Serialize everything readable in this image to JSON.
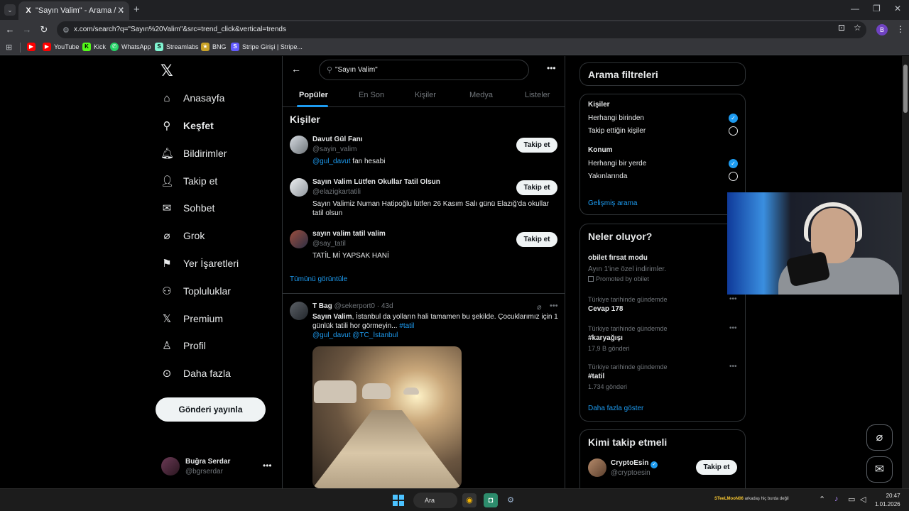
{
  "browser": {
    "tab_title": "\"Sayın Valim\" - Arama / X",
    "tab_favicon": "X",
    "url": "x.com/search?q=\"Sayın%20Valim\"&src=trend_click&vertical=trends",
    "profile_initial": "B",
    "bookmarks": [
      "YouTube",
      "Kick",
      "WhatsApp",
      "Streamlabs",
      "BNG",
      "Stripe Girişi | Stripe..."
    ]
  },
  "sidebar": {
    "items": [
      {
        "label": "Anasayfa",
        "icon": "home-icon"
      },
      {
        "label": "Keşfet",
        "icon": "search-icon"
      },
      {
        "label": "Bildirimler",
        "icon": "bell-icon"
      },
      {
        "label": "Takip et",
        "icon": "add-user-icon"
      },
      {
        "label": "Sohbet",
        "icon": "mail-icon"
      },
      {
        "label": "Grok",
        "icon": "grok-icon"
      },
      {
        "label": "Yer İşaretleri",
        "icon": "bookmark-icon"
      },
      {
        "label": "Topluluklar",
        "icon": "communities-icon"
      },
      {
        "label": "Premium",
        "icon": "x-icon"
      },
      {
        "label": "Profil",
        "icon": "person-icon"
      },
      {
        "label": "Daha fazla",
        "icon": "more-circle-icon"
      }
    ],
    "post_button": "Gönderi yayınla",
    "account": {
      "name": "Buğra Serdar",
      "handle": "@bgrserdar"
    }
  },
  "search": {
    "query": "\"Sayın Valim\"",
    "tabs": [
      "Popüler",
      "En Son",
      "Kişiler",
      "Medya",
      "Listeler"
    ],
    "active_tab": "Popüler"
  },
  "people": {
    "heading": "Kişiler",
    "follow_label": "Takip et",
    "users": [
      {
        "name": "Davut Gül Fanı",
        "handle": "@sayin_valim",
        "bio_mention": "@gul_davut",
        "bio": " fan hesabi"
      },
      {
        "name": "Sayın Valim Lütfen Okullar Tatil Olsun",
        "handle": "@elazigkartatili",
        "bio_mention": "",
        "bio": "Sayın Valimiz Numan Hatipoğlu lütfen 26 Kasım Salı günü Elazığ'da okullar tatil olsun"
      },
      {
        "name": "sayın valim tatil valim",
        "handle": "@say_tatil",
        "bio_mention": "",
        "bio": "TATİL Mİ YAPSAK HANİ"
      }
    ],
    "show_all": "Tümünü görüntüle"
  },
  "tweet": {
    "author": "T Bag",
    "handle": "@sekerport0",
    "time": "· 43d",
    "bold_lead": "Sayın Valim",
    "text": ", İstanbul da yolların hali tamamen bu şekilde. Çocuklarımız için 1 günlük tatili hor görmeyin... ",
    "hashtag": "#tatil",
    "mentions": "@gul_davut @TC_İstanbul"
  },
  "filters": {
    "title": "Arama filtreleri",
    "people_label": "Kişiler",
    "people_options": [
      "Herhangi birinden",
      "Takip ettiğin kişiler"
    ],
    "location_label": "Konum",
    "location_options": [
      "Herhangi bir yerde",
      "Yakınlarında"
    ],
    "advanced": "Gelişmiş arama"
  },
  "trends": {
    "title": "Neler oluyor?",
    "promo": {
      "name": "obilet fırsat modu",
      "desc": "Ayın 1'ine özel indirimler.",
      "promoted": "Promoted by obilet"
    },
    "items": [
      {
        "meta": "Türkiye tarihinde gündemde",
        "name": "Cevap 178",
        "count": ""
      },
      {
        "meta": "Türkiye tarihinde gündemde",
        "name": "#karyağışı",
        "count": "17,9 B gönderi"
      },
      {
        "meta": "Türkiye tarihinde gündemde",
        "name": "#tatil",
        "count": "1.734 gönderi"
      }
    ],
    "show_more": "Daha fazla göster"
  },
  "who_to_follow": {
    "title": "Kimi takip etmeli",
    "user": {
      "name": "CryptoEsin",
      "handle": "@cryptoesin"
    },
    "follow_label": "Takip et"
  },
  "taskbar": {
    "search_label": "Ara",
    "ticker_name": "STeeLMooN06",
    "ticker_text": " arkadaş hiç burda değil",
    "time": "20:47",
    "date": "1.01.2026"
  },
  "colors": {
    "accent": "#1d9bf0",
    "background": "#000000",
    "text": "#e7e9ea",
    "muted": "#71767b",
    "border": "#2f3336"
  }
}
